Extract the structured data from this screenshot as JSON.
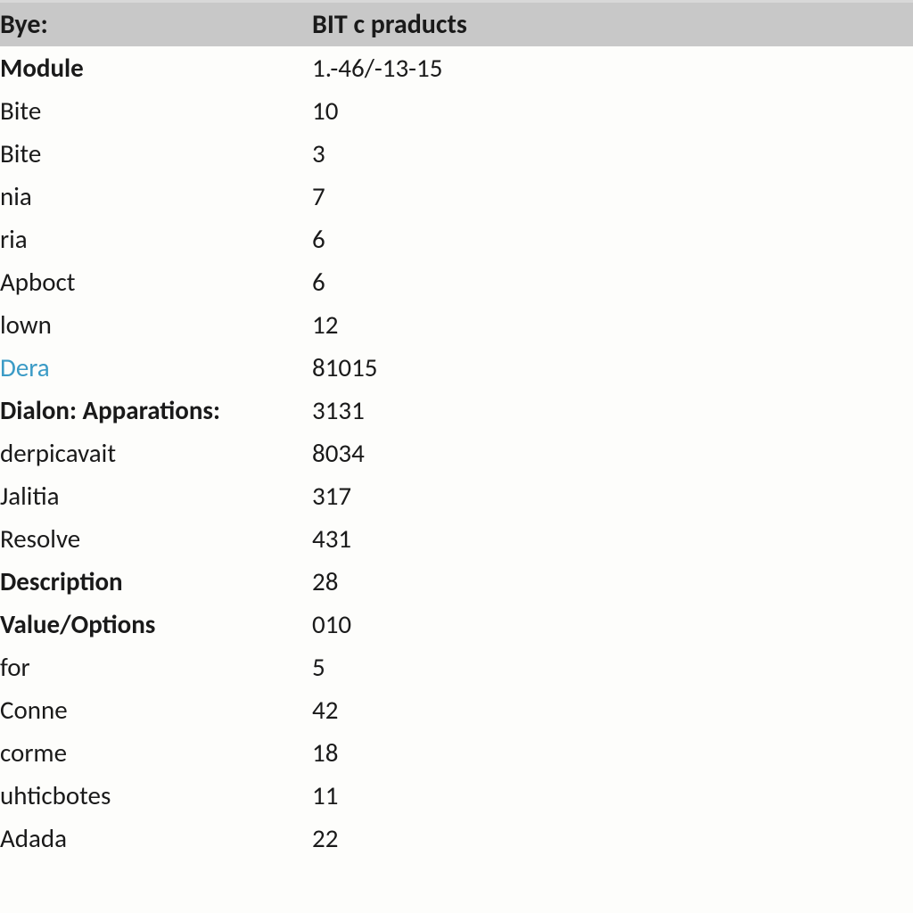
{
  "header": {
    "col1": "Bye:",
    "col2": "BIT c praducts"
  },
  "rows": [
    {
      "label": "Module",
      "value": "1.-46/-13-15",
      "label_bold": true,
      "value_bold": false,
      "link": false
    },
    {
      "label": "Bite",
      "value": "10",
      "label_bold": false,
      "value_bold": false,
      "link": false
    },
    {
      "label": "Bite",
      "value": "3",
      "label_bold": false,
      "value_bold": false,
      "link": false
    },
    {
      "label": "nia",
      "value": "7",
      "label_bold": false,
      "value_bold": false,
      "link": false
    },
    {
      "label": "ria",
      "value": "6",
      "label_bold": false,
      "value_bold": false,
      "link": false
    },
    {
      "label": "Apboct",
      "value": "6",
      "label_bold": false,
      "value_bold": false,
      "link": false
    },
    {
      "label": "lown",
      "value": "12",
      "label_bold": false,
      "value_bold": false,
      "link": false
    },
    {
      "label": "Dera",
      "value": "81015",
      "label_bold": false,
      "value_bold": false,
      "link": true
    },
    {
      "label": "Dialon: Apparations:",
      "value": "3131",
      "label_bold": true,
      "value_bold": false,
      "link": false
    },
    {
      "label": "derpicavait",
      "value": "8034",
      "label_bold": false,
      "value_bold": false,
      "link": false
    },
    {
      "label": "Jalitia",
      "value": "317",
      "label_bold": false,
      "value_bold": false,
      "link": false
    },
    {
      "label": "Resolve",
      "value": "431",
      "label_bold": false,
      "value_bold": false,
      "link": false
    },
    {
      "label": "Description",
      "value": "28",
      "label_bold": true,
      "value_bold": false,
      "link": false
    },
    {
      "label": "Value/Options",
      "value": "010",
      "label_bold": true,
      "value_bold": false,
      "link": false
    },
    {
      "label": "for",
      "value": "5",
      "label_bold": false,
      "value_bold": false,
      "link": false
    },
    {
      "label": "Conne",
      "value": "42",
      "label_bold": false,
      "value_bold": false,
      "link": false
    },
    {
      "label": "corme",
      "value": "18",
      "label_bold": false,
      "value_bold": false,
      "link": false
    },
    {
      "label": "uhticbotes",
      "value": "11",
      "label_bold": false,
      "value_bold": false,
      "link": false
    },
    {
      "label": "Adada",
      "value": "22",
      "label_bold": false,
      "value_bold": false,
      "link": false
    }
  ]
}
